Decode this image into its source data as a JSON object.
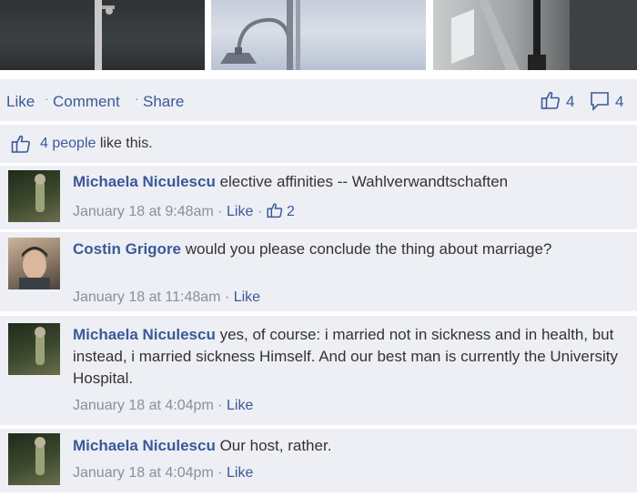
{
  "actions": {
    "like": "Like",
    "comment": "Comment",
    "share": "Share",
    "separator": "·"
  },
  "counts": {
    "likes": "4",
    "comments": "4"
  },
  "likes_summary": {
    "people": "4 people",
    "suffix": "like this."
  },
  "comments": [
    {
      "author": "Michaela Niculescu",
      "text": "elective affinities -- Wahlverwandtschaften",
      "time": "January 18 at 9:48am",
      "like": "Like",
      "like_count": "2"
    },
    {
      "author": "Costin Grigore",
      "text": "would you please conclude the thing about marriage?",
      "time": "January 18 at 11:48am",
      "like": "Like"
    },
    {
      "author": "Michaela Niculescu",
      "text": "yes, of course: i married not in sickness and in health, but instead, i married sickness Himself. And our best man is currently the University Hospital.",
      "time": "January 18 at 4:04pm",
      "like": "Like"
    },
    {
      "author": "Michaela Niculescu",
      "text": "Our host, rather.",
      "time": "January 18 at 4:04pm",
      "like": "Like"
    }
  ],
  "colors": {
    "link": "#3b5998",
    "panel": "#edeff4",
    "meta": "#898f9c"
  },
  "icons": [
    "thumbs-up-icon",
    "comment-bubble-icon"
  ]
}
